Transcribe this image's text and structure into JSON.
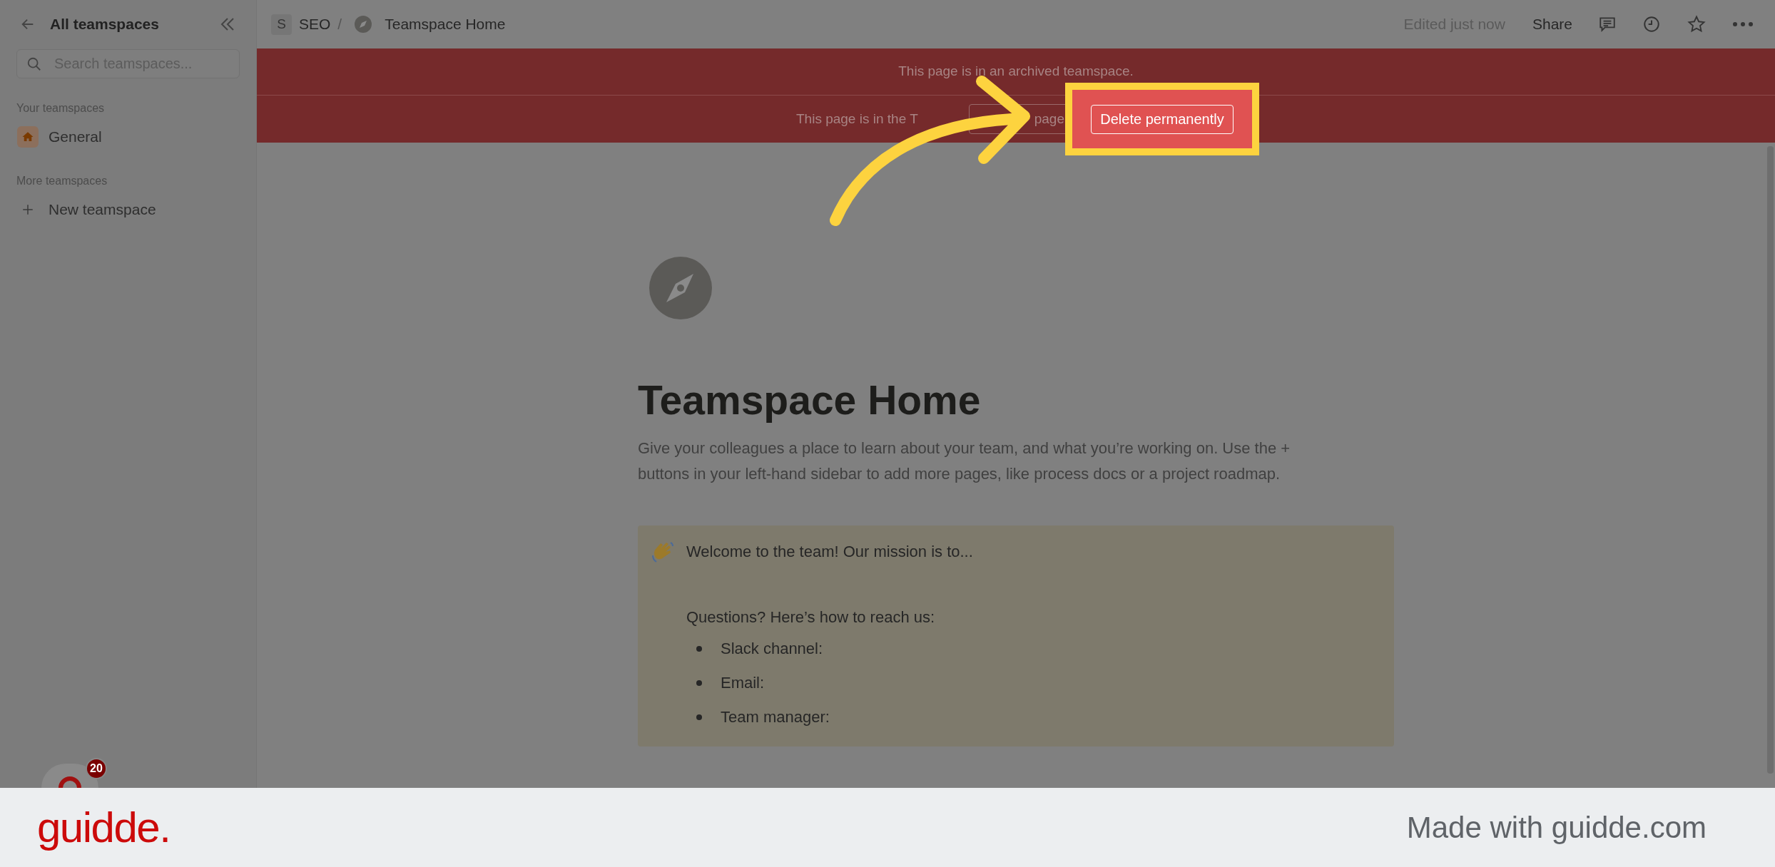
{
  "sidebar": {
    "title": "All teamspaces",
    "search": {
      "placeholder": "Search teamspaces..."
    },
    "sections": [
      {
        "heading": "Your teamspaces",
        "items": [
          {
            "label": "General",
            "kind": "teamspace"
          }
        ]
      },
      {
        "heading": "More teamspaces",
        "items": [
          {
            "label": "New teamspace",
            "kind": "action"
          }
        ]
      }
    ],
    "avatar": {
      "badge": "20"
    }
  },
  "topbar": {
    "workspace_initial": "S",
    "workspace": "SEO",
    "separator": "/",
    "page": "Teamspace Home",
    "status": "Edited just now",
    "share": "Share"
  },
  "banner": {
    "notice": "This page is in an archived teamspace.",
    "trash_text": "This page is in the T",
    "restore_button": "page",
    "delete_button": "Delete permanently"
  },
  "page": {
    "title": "Teamspace Home",
    "description": "Give your colleagues a place to learn about your team, and what you’re working on. Use the + buttons in your left-hand sidebar to add more pages, like process docs or a project roadmap.",
    "callout": {
      "heading": "Welcome to the team! Our mission is to...",
      "questions": "Questions? Here’s how to reach us:",
      "bullets": [
        "Slack channel:",
        "Email:",
        "Team manager:"
      ]
    }
  },
  "footer": {
    "logo": "guidde.",
    "tagline": "Made with guidde.com"
  }
}
